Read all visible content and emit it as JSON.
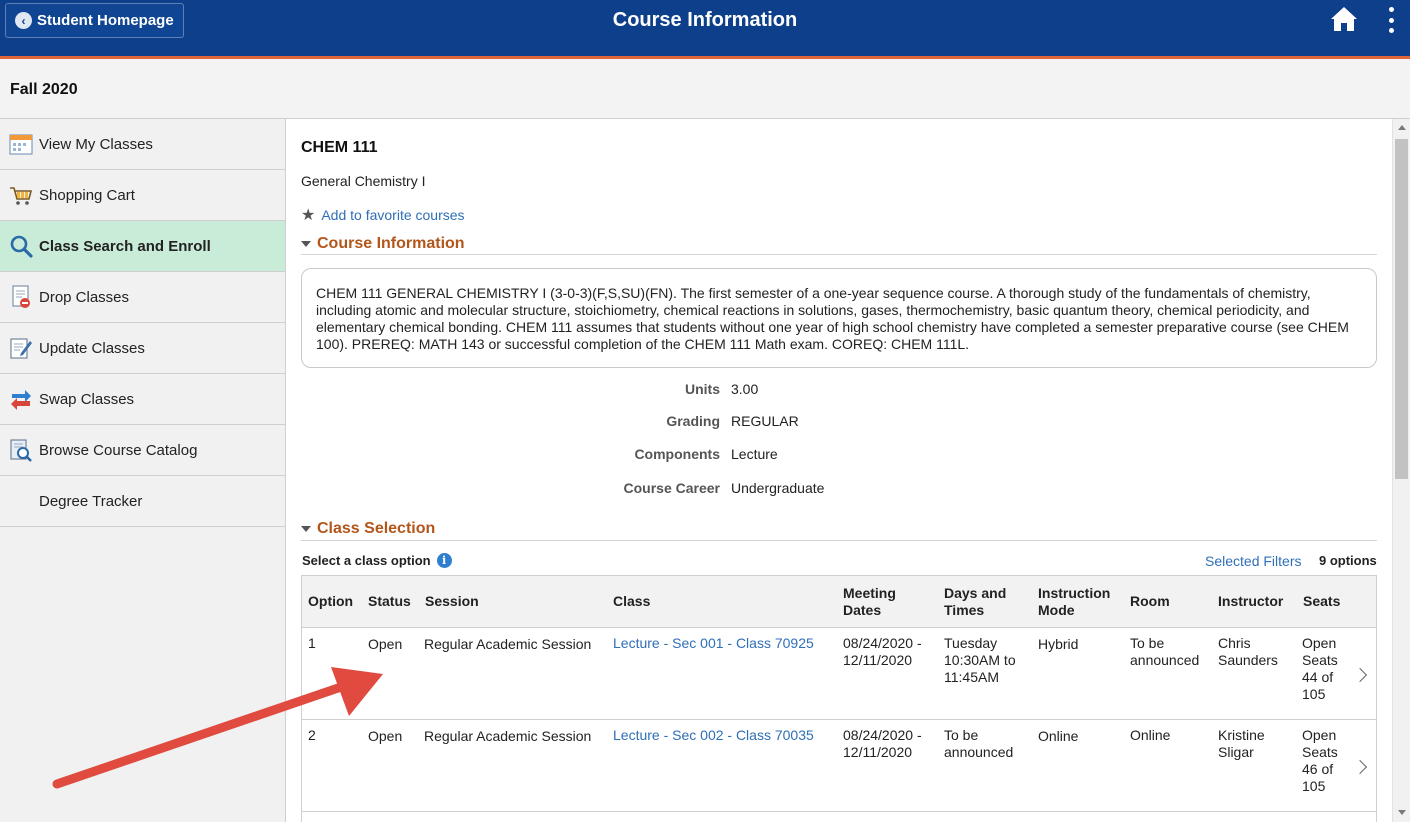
{
  "header": {
    "back_label": "Student Homepage",
    "title": "Course Information",
    "colors": {
      "bar": "#0d3f8a",
      "accent": "#e0653a"
    }
  },
  "term": "Fall 2020",
  "sidebar": {
    "items": [
      {
        "label": "View My Classes",
        "icon": "calendar-icon"
      },
      {
        "label": "Shopping Cart",
        "icon": "shopping-cart-icon"
      },
      {
        "label": "Class Search and Enroll",
        "icon": "search-icon",
        "active": true
      },
      {
        "label": "Drop Classes",
        "icon": "drop-classes-icon"
      },
      {
        "label": "Update Classes",
        "icon": "edit-document-icon"
      },
      {
        "label": "Swap Classes",
        "icon": "swap-arrows-icon"
      },
      {
        "label": "Browse Course Catalog",
        "icon": "catalog-search-icon"
      },
      {
        "label": "Degree Tracker",
        "icon": ""
      }
    ]
  },
  "course": {
    "code": "CHEM 111",
    "name": "General Chemistry I",
    "favorite_label": "Add to favorite courses",
    "info_section_title": "Course Information",
    "description": "CHEM 111 GENERAL CHEMISTRY I (3-0-3)(F,S,SU)(FN). The first semester of a one-year sequence course. A thorough study of the fundamentals of chemistry, including atomic and molecular structure, stoichiometry, chemical reactions in solutions, gases, thermochemistry, basic quantum theory, chemical periodicity, and elementary chemical bonding. CHEM 111 assumes that students without one year of high school chemistry have completed a semester preparative course (see CHEM 100). PREREQ: MATH 143 or successful completion of the CHEM 111 Math exam. COREQ: CHEM 111L.",
    "details": {
      "units_label": "Units",
      "units_value": "3.00",
      "grading_label": "Grading",
      "grading_value": "REGULAR",
      "components_label": "Components",
      "components_value": "Lecture",
      "career_label": "Course Career",
      "career_value": "Undergraduate"
    }
  },
  "class_selection": {
    "title": "Class Selection",
    "select_label": "Select a class option",
    "filters_label": "Selected Filters",
    "options_count": "9 options",
    "columns": {
      "option": "Option",
      "status": "Status",
      "session": "Session",
      "class": "Class",
      "meeting_dates": "Meeting Dates",
      "days_times": "Days and Times",
      "instruction_mode": "Instruction Mode",
      "room": "Room",
      "instructor": "Instructor",
      "seats": "Seats"
    },
    "rows": [
      {
        "option": "1",
        "status": "Open",
        "session": "Regular Academic Session",
        "class": "Lecture - Sec 001 - Class 70925",
        "meeting_dates": "08/24/2020 - 12/11/2020",
        "days_times": "Tuesday 10:30AM to 11:45AM",
        "instruction_mode": "Hybrid",
        "room": "To be announced",
        "instructor": "Chris Saunders",
        "seats": "Open Seats 44 of 105"
      },
      {
        "option": "2",
        "status": "Open",
        "session": "Regular Academic Session",
        "class": "Lecture - Sec 002 - Class 70035",
        "meeting_dates": "08/24/2020 - 12/11/2020",
        "days_times": "To be announced",
        "instruction_mode": "Online",
        "room": "Online",
        "instructor": "Kristine Sligar",
        "seats": "Open Seats 46 of 105"
      }
    ]
  },
  "annotation_arrow_color": "#e04a3f"
}
